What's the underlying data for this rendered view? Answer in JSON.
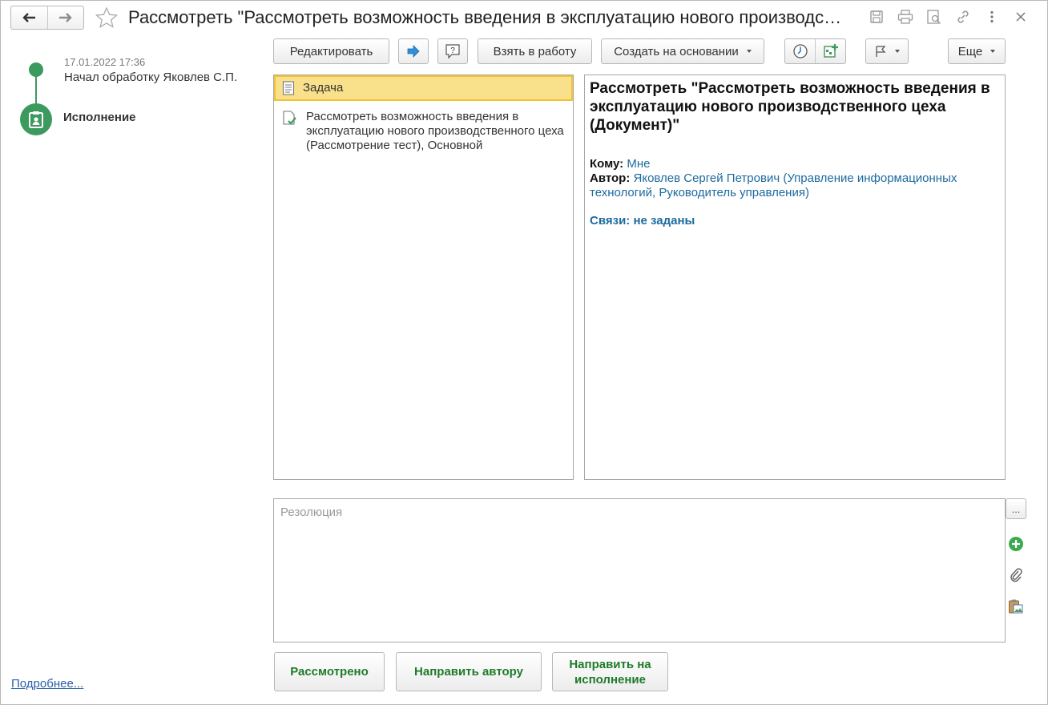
{
  "title": "Рассмотреть \"Рассмотреть возможность введения в эксплуатацию нового производственного цеха (Документ)\"",
  "title_icons": [
    "save-icon",
    "print-icon",
    "preview-icon",
    "link-icon",
    "more-vertical-icon",
    "close-icon"
  ],
  "timeline": {
    "date": "17.01.2022 17:36",
    "event": "Начал обработку Яковлев С.П.",
    "stage": "Исполнение",
    "more_link": "Подробнее..."
  },
  "toolbar": {
    "edit": "Редактировать",
    "take": "Взять в работу",
    "create_based": "Создать на основании",
    "more": "Еще"
  },
  "tree": {
    "task": "Задача",
    "doc": "Рассмотреть возможность введения в эксплуатацию нового производственного цеха (Рассмотрение тест), Основной"
  },
  "info": {
    "heading": "Рассмотреть \"Рассмотреть возможность введения в эксплуатацию нового производственного цеха (Документ)\"",
    "to_label": "Кому:",
    "to_value": "Мне",
    "author_label": "Автор:",
    "author_value": "Яковлев Сергей Петрович (Управление информационных технологий, Руководитель управления)",
    "links": "Связи: не заданы"
  },
  "resolution": {
    "placeholder": "Резолюция",
    "dots": "..."
  },
  "actions": {
    "reviewed": "Рассмотрено",
    "send_author": "Направить автору",
    "send_exec": "Направить на исполнение"
  },
  "colors": {
    "accent_green": "#3c9a5f",
    "selection": "#f9e08a",
    "link": "#1d6a9e",
    "action_text": "#1f7a2a"
  }
}
